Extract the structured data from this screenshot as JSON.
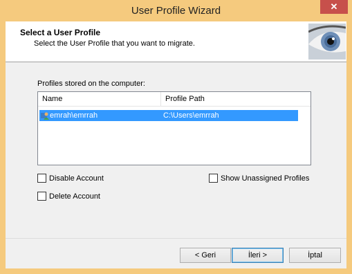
{
  "window": {
    "title": "User Profile Wizard",
    "close_glyph": "✕"
  },
  "header": {
    "title": "Select a User Profile",
    "subtitle": "Select the User Profile that you want to migrate.",
    "image_icon": "eye-icon"
  },
  "profiles": {
    "label": "Profiles stored on the computer:",
    "columns": [
      "Name",
      "Profile Path"
    ],
    "rows": [
      {
        "name": "emrah\\emrrah",
        "path": "C:\\Users\\emrrah",
        "selected": true
      }
    ]
  },
  "options": {
    "disable_account": "Disable Account",
    "delete_account": "Delete Account",
    "show_unassigned": "Show Unassigned Profiles"
  },
  "buttons": {
    "back": "< Geri",
    "next": "İleri >",
    "cancel": "İptal"
  },
  "colors": {
    "frame": "#f5ca7e",
    "selection": "#3399ff",
    "close": "#c7504b"
  }
}
